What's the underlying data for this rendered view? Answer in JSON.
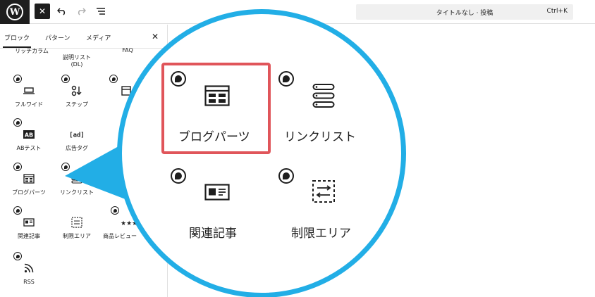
{
  "topbar": {
    "logo": "W",
    "close_symbol": "✕",
    "document_title": "タイトルなし · 投稿",
    "shortcut": "Ctrl+K"
  },
  "sidebar": {
    "tabs": [
      {
        "label": "ブロック"
      },
      {
        "label": "パターン"
      },
      {
        "label": "メディア"
      }
    ],
    "close_symbol": "✕",
    "partial_labels": [
      "リッチカラム",
      "説明リスト\n(DL)",
      "FAQ"
    ],
    "items": [
      {
        "label": "フルワイド"
      },
      {
        "label": "ステップ"
      },
      {
        "label": "ABテスト"
      },
      {
        "label": "広告タグ"
      },
      {
        "label": "ブログパーツ"
      },
      {
        "label": "リンクリスト"
      },
      {
        "label": "関連記事"
      },
      {
        "label": "制限エリア"
      },
      {
        "label": "商品レビュー"
      },
      {
        "label": "RSS"
      }
    ]
  },
  "magnifier": {
    "items": [
      {
        "label": "ブログパーツ",
        "highlighted": true
      },
      {
        "label": "リンクリスト"
      },
      {
        "label": "関連記事"
      },
      {
        "label": "制限エリア"
      }
    ]
  },
  "colors": {
    "accent": "#22aee6",
    "highlight": "#e0555a",
    "dark": "#1e1e1e"
  }
}
